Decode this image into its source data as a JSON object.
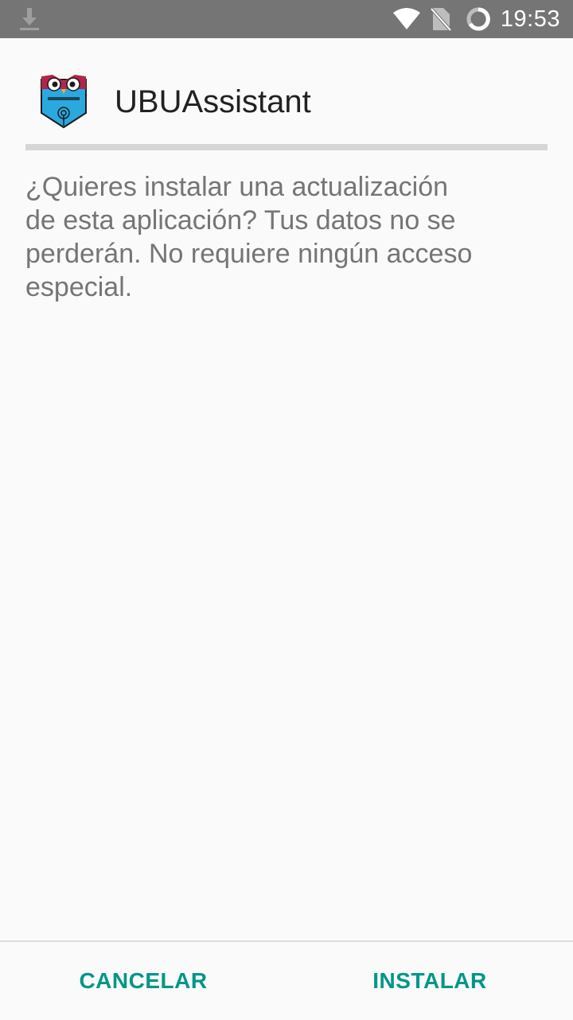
{
  "status_bar": {
    "time": "19:53",
    "icons": [
      "download-icon",
      "wifi-icon",
      "no-sim-icon",
      "battery-icon"
    ]
  },
  "app": {
    "name": "UBUAssistant",
    "icon": "owl-logo-icon"
  },
  "dialog": {
    "message_lines": [
      "¿Quieres instalar una actualización",
      "de esta aplicación? Tus datos no se",
      "perderán. No requiere ningún acceso",
      "especial."
    ]
  },
  "actions": {
    "cancel_label": "CANCELAR",
    "install_label": "INSTALAR"
  },
  "colors": {
    "accent": "#009688",
    "status_bar": "#757575",
    "background": "#fafafa"
  }
}
